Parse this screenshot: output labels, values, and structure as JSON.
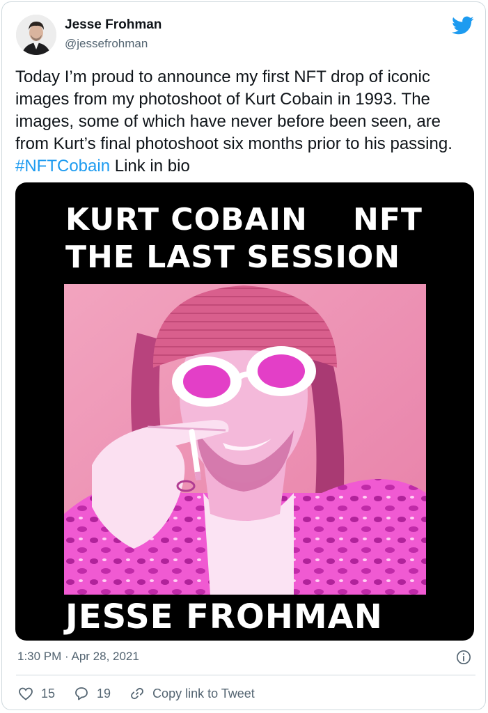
{
  "tweet": {
    "author_name": "Jesse Frohman",
    "author_handle": "@jessefrohman",
    "text_main": "Today I’m proud to announce my first NFT drop of iconic images from my photoshoot of Kurt Cobain in 1993. The images, some of which have never before been seen, are from Kurt’s final photoshoot six months prior to his passing. ",
    "hashtag": "#NFTCobain",
    "text_tail": "  Link in bio",
    "timestamp": "1:30 PM · Apr 28, 2021"
  },
  "media": {
    "title_line1": "KURT COBAIN    NFT",
    "title_line2": "THE LAST SESSION",
    "credit": "JESSE FROHMAN"
  },
  "actions": {
    "likes": "15",
    "replies": "19",
    "copy_link": "Copy link to Tweet"
  },
  "colors": {
    "brand": "#1d9bf0",
    "text": "#0f1419",
    "muted": "#536471",
    "photo_tint": "#ee3fd8"
  },
  "icons": [
    "twitter-bird-icon",
    "info-icon",
    "heart-icon",
    "reply-icon",
    "link-icon"
  ]
}
